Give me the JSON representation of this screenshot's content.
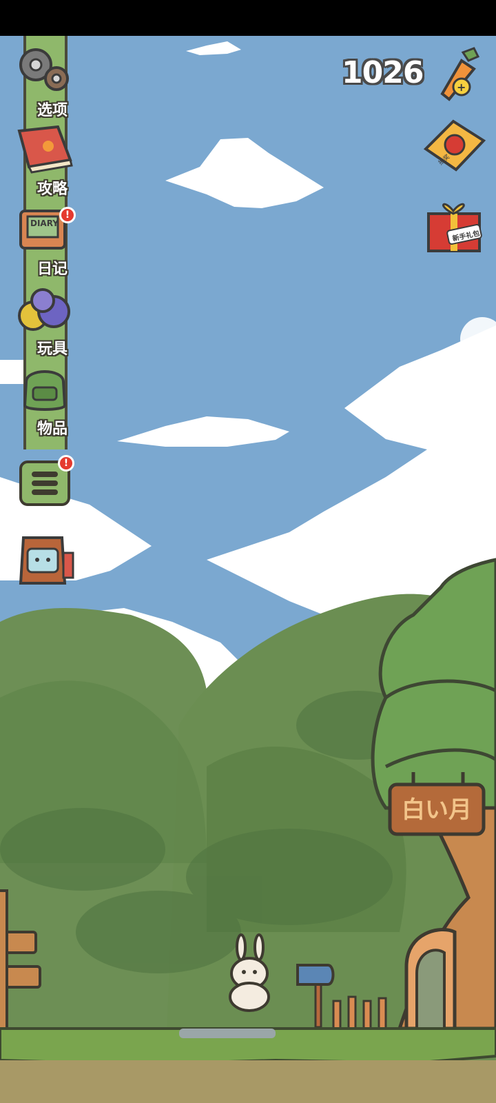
{
  "menu": {
    "items": [
      {
        "label": "选项",
        "icon": "gear-icon"
      },
      {
        "label": "攻略",
        "icon": "guide-book-icon"
      },
      {
        "label": "日记",
        "icon": "diary-icon"
      },
      {
        "label": "玩具",
        "icon": "toy-balls-icon"
      },
      {
        "label": "物品",
        "icon": "backpack-icon"
      }
    ],
    "extra_menu_icon": "list-menu-icon",
    "badge_text": "!"
  },
  "currency": {
    "amount": "1026",
    "icon": "carrot-add-icon"
  },
  "right_buttons": [
    {
      "icon": "tomato-ticket-icon",
      "ticket_text": "抽奖"
    },
    {
      "icon": "gift-box-icon",
      "gift_text": "新手礼包"
    }
  ],
  "lantern_icon": "lantern-shop-icon",
  "tree_house_sign": "白い月",
  "colors": {
    "sky": "#7ba8d0",
    "strip": "#8fb86b",
    "badge": "#e53a2f",
    "grass": "#7aa54e",
    "dirt": "#a89966"
  }
}
